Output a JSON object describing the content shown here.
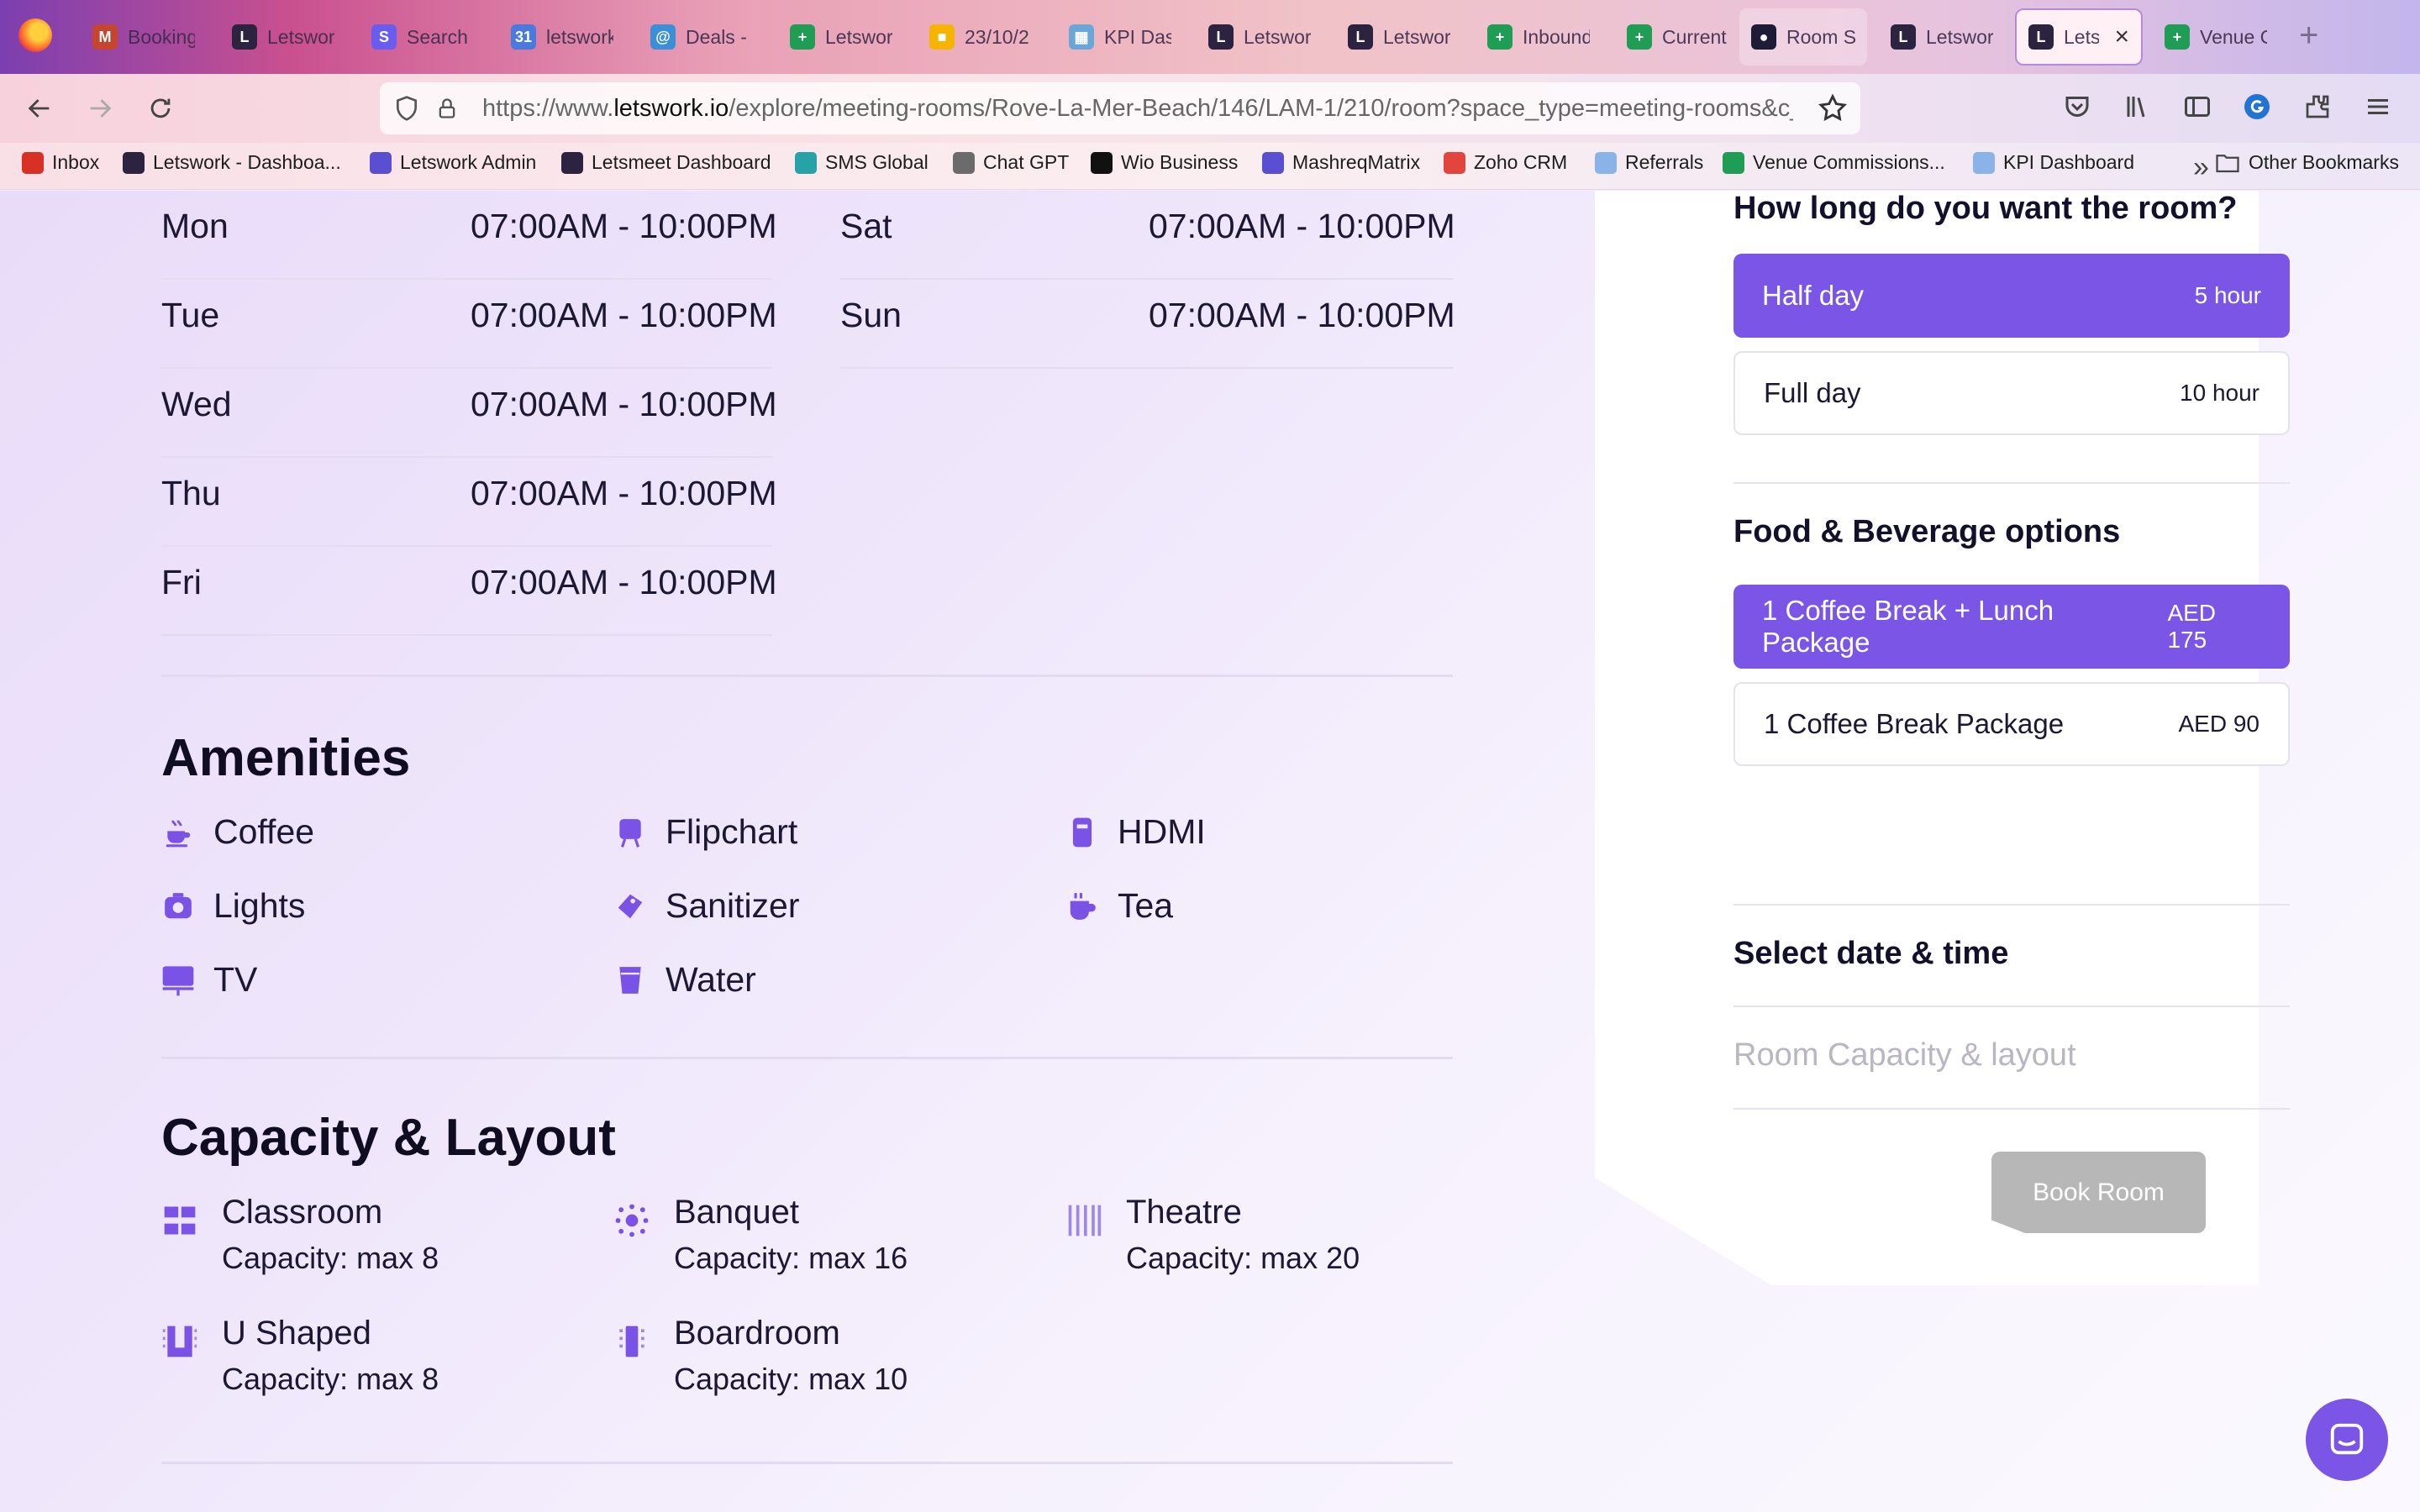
{
  "browser": {
    "tabs": [
      {
        "title": "Booking",
        "fav_color": "#c6452e",
        "fav_glyph": "M"
      },
      {
        "title": "Letswork",
        "fav_color": "#2b2340",
        "fav_glyph": "L"
      },
      {
        "title": "Search",
        "fav_color": "#6b5cf0",
        "fav_glyph": "S"
      },
      {
        "title": "letswork",
        "fav_color": "#4a7bdc",
        "fav_glyph": "31"
      },
      {
        "title": "Deals -",
        "fav_color": "#3a8fd6",
        "fav_glyph": "@"
      },
      {
        "title": "Letswork",
        "fav_color": "#1f9d55",
        "fav_glyph": "+"
      },
      {
        "title": "23/10/2",
        "fav_color": "#f4b400",
        "fav_glyph": "■"
      },
      {
        "title": "KPI Das",
        "fav_color": "#6aa7d8",
        "fav_glyph": "▦"
      },
      {
        "title": "Letswork",
        "fav_color": "#2b2340",
        "fav_glyph": "L"
      },
      {
        "title": "Letswork",
        "fav_color": "#2b2340",
        "fav_glyph": "L"
      },
      {
        "title": "Inbound",
        "fav_color": "#1f9d55",
        "fav_glyph": "+"
      },
      {
        "title": "Current",
        "fav_color": "#1f9d55",
        "fav_glyph": "+"
      },
      {
        "title": "Room S",
        "fav_color": "#1e1b36",
        "fav_glyph": "●"
      },
      {
        "title": "Letswork",
        "fav_color": "#2b2340",
        "fav_glyph": "L"
      },
      {
        "title": "Lets",
        "fav_color": "#2b2340",
        "fav_glyph": "L"
      },
      {
        "title": "Venue C",
        "fav_color": "#1f9d55",
        "fav_glyph": "+"
      }
    ],
    "url_prefix": "https://www.",
    "url_domain": "letswork.io",
    "url_rest": "/explore/meeting-rooms/Rove-La-Mer-Beach/146/LAM-1/210/room?space_type=meeting-rooms&c_c",
    "bookmarks": [
      {
        "label": "Inbox",
        "color": "#d93025"
      },
      {
        "label": "Letswork - Dashboa...",
        "color": "#2b2340"
      },
      {
        "label": "Letswork Admin",
        "color": "#5a4fd0"
      },
      {
        "label": "Letsmeet Dashboard",
        "color": "#2b2340"
      },
      {
        "label": "SMS Global",
        "color": "#27a3a8"
      },
      {
        "label": "Chat GPT",
        "color": "#6b6b6b"
      },
      {
        "label": "Wio Business",
        "color": "#111111"
      },
      {
        "label": "MashreqMatrix",
        "color": "#5a4fd0"
      },
      {
        "label": "Zoho CRM",
        "color": "#e2453c"
      },
      {
        "label": "Referrals",
        "color": "#8ab4e8"
      },
      {
        "label": "Venue Commissions...",
        "color": "#1f9d55"
      },
      {
        "label": "KPI Dashboard",
        "color": "#8ab4e8"
      }
    ],
    "bookmarks_overflow": "»",
    "other_bookmarks": "Other Bookmarks"
  },
  "hours": {
    "left": [
      {
        "day": "Mon",
        "time": "07:00AM - 10:00PM"
      },
      {
        "day": "Tue",
        "time": "07:00AM - 10:00PM"
      },
      {
        "day": "Wed",
        "time": "07:00AM - 10:00PM"
      },
      {
        "day": "Thu",
        "time": "07:00AM - 10:00PM"
      },
      {
        "day": "Fri",
        "time": "07:00AM - 10:00PM"
      }
    ],
    "right": [
      {
        "day": "Sat",
        "time": "07:00AM - 10:00PM"
      },
      {
        "day": "Sun",
        "time": "07:00AM - 10:00PM"
      }
    ]
  },
  "amenities": {
    "title": "Amenities",
    "items": [
      {
        "label": "Coffee",
        "icon": "coffee-icon"
      },
      {
        "label": "Flipchart",
        "icon": "flipchart-icon"
      },
      {
        "label": "HDMI",
        "icon": "hdmi-icon"
      },
      {
        "label": "Lights",
        "icon": "lights-icon"
      },
      {
        "label": "Sanitizer",
        "icon": "sanitizer-icon"
      },
      {
        "label": "Tea",
        "icon": "tea-icon"
      },
      {
        "label": "TV",
        "icon": "tv-icon"
      },
      {
        "label": "Water",
        "icon": "water-icon"
      }
    ]
  },
  "capacity": {
    "title": "Capacity & Layout",
    "items": [
      {
        "name": "Classroom",
        "capacity": "Capacity: max 8",
        "icon": "classroom-icon"
      },
      {
        "name": "Banquet",
        "capacity": "Capacity: max 16",
        "icon": "banquet-icon"
      },
      {
        "name": "Theatre",
        "capacity": "Capacity: max 20",
        "icon": "theatre-icon"
      },
      {
        "name": "U Shaped",
        "capacity": "Capacity: max 8",
        "icon": "u-shaped-icon"
      },
      {
        "name": "Boardroom",
        "capacity": "Capacity: max 10",
        "icon": "boardroom-icon"
      }
    ]
  },
  "booking": {
    "duration_title": "How long do you want the room?",
    "durations": [
      {
        "label": "Half day",
        "value": "5 hour",
        "selected": true
      },
      {
        "label": "Full day",
        "value": "10 hour",
        "selected": false
      }
    ],
    "fnb_title": "Food & Beverage options",
    "fnb": [
      {
        "label": "1 Coffee Break + Lunch Package",
        "value": "AED 175",
        "selected": true
      },
      {
        "label": "1 Coffee Break Package",
        "value": "AED 90",
        "selected": false
      }
    ],
    "date_title": "Select date & time",
    "capacity_placeholder": "Room Capacity & layout",
    "book_label": "Book Room"
  },
  "colors": {
    "accent": "#7a55e6",
    "disabled": "#b7b7b7"
  }
}
